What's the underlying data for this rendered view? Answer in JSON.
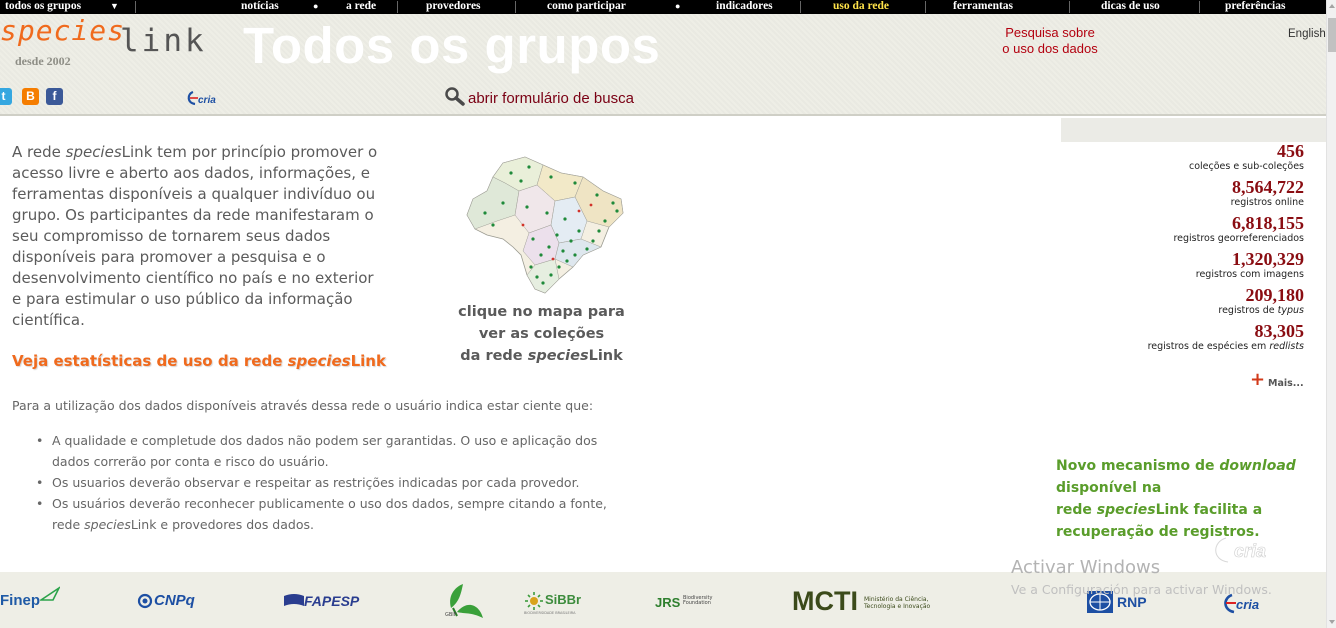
{
  "nav": {
    "group_dropdown": "todos os grupos",
    "group_dropdown_arrow": "▼",
    "items": [
      "notícias",
      "a rede",
      "provedores",
      "como participar",
      "indicadores",
      "uso da rede",
      "ferramentas",
      "dicas de uso",
      "preferências"
    ],
    "active_item": "uso da rede",
    "dot": "●"
  },
  "header": {
    "logo_species": "species",
    "logo_link": "link",
    "since": "desde 2002",
    "title": "Todos os grupos",
    "survey_link": [
      "Pesquisa sobre",
      "o uso dos dados"
    ],
    "language_link": "English",
    "social_icons": [
      "twitter-icon",
      "blogger-icon",
      "facebook-icon"
    ],
    "social_glyphs": [
      "t",
      "B",
      "f"
    ],
    "cria_logo_text": "cria",
    "search_link": "abrir formulário de busca"
  },
  "main": {
    "intro_lines": [
      "A rede speciesLink tem por princípio promover o",
      "acesso livre e aberto aos dados, informações, e",
      "ferramentas disponíveis a qualquer indivíduo ou",
      "grupo. Os participantes da rede manifestaram o",
      "seu compromisso de tornarem seus dados",
      "disponíveis para promover a pesquisa e o",
      "desenvolvimento científico no país e no exterior",
      "e para estimular o uso público da informação",
      "científica."
    ],
    "stats_link": "Veja estatísticas de uso da rede speciesLink",
    "disclaimer": "Para a utilização dos dados disponíveis através dessa rede o usuário indica estar ciente que:",
    "conditions": [
      [
        "A qualidade e completude dos dados não podem ser garantidas. O uso e aplicação dos",
        "dados correrão por conta e risco do usuário."
      ],
      [
        "Os usuarios deverão observar e respeitar as restrições indicadas por cada provedor."
      ],
      [
        "Os usuários deverão reconhecer publicamente o uso dos dados, sempre citando a fonte,",
        "rede speciesLink e provedores dos dados."
      ]
    ],
    "map_caption": [
      "clique no mapa para",
      "ver as coleções",
      "da rede speciesLink"
    ]
  },
  "stats_panel": {
    "stats": [
      {
        "value": "456",
        "label": "coleções e sub-coleções"
      },
      {
        "value": "8,564,722",
        "label": "registros online"
      },
      {
        "value": "6,818,155",
        "label": "registros georreferenciados"
      },
      {
        "value": "1,320,329",
        "label": "registros com imagens"
      },
      {
        "value": "209,180",
        "label": "registros de typus"
      },
      {
        "value": "83,305",
        "label": "registros de espécies em redlists"
      }
    ],
    "more_plus": "+",
    "more_link": "Mais...",
    "news": [
      "Novo mecanismo de download",
      "disponível na",
      "rede speciesLink facilita a",
      "recuperação de registros."
    ]
  },
  "footer": {
    "partners": [
      "Finep",
      "CNPq",
      "FAPESP",
      "GBIF",
      "SiBBr",
      "JRS",
      "MCTI",
      "RNP",
      "cria"
    ],
    "partner_sublabels": {
      "gbif": "GBIF",
      "sibbr": "BIODIVERSIDADE BRASILEIRA",
      "jrs": [
        "Biodiversity",
        "Foundation"
      ],
      "mcti": [
        "Ministério da Ciência,",
        "Tecnologia e Inovação"
      ]
    }
  },
  "watermark": {
    "title": "Activar Windows",
    "subtitle": "Ve a Configuración para activar Windows."
  },
  "colors": {
    "accent_orange": "#f06a1d",
    "stat_red": "#8a0d12",
    "news_green": "#5a9d2b",
    "nav_active": "#ffe34a"
  }
}
